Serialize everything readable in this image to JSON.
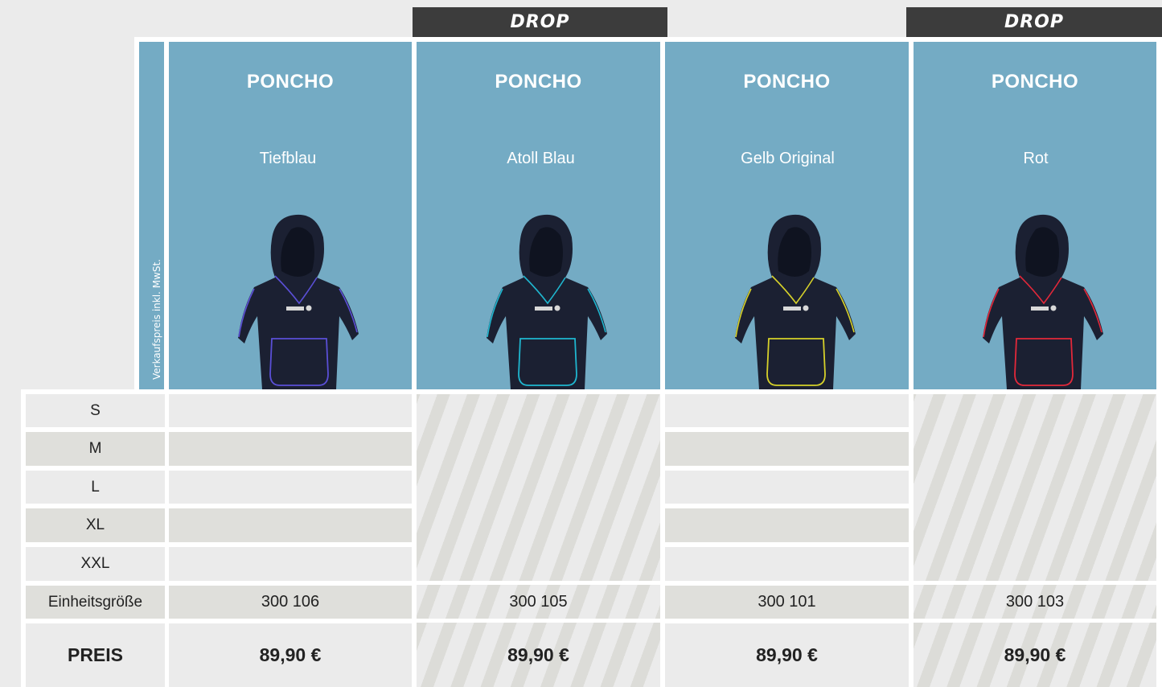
{
  "drop_banners": [
    "DROP",
    "DROP"
  ],
  "side_label": "Verkaufspreis inkl. MwSt.",
  "products": [
    {
      "name": "PONCHO",
      "color": "Tiefblau",
      "trim": "#5a4fd6",
      "article": "300 106",
      "price": "89,90 €",
      "drop": false
    },
    {
      "name": "PONCHO",
      "color": "Atoll Blau",
      "trim": "#1fb6cf",
      "article": "300 105",
      "price": "89,90 €",
      "drop": true
    },
    {
      "name": "PONCHO",
      "color": "Gelb Original",
      "trim": "#d6d12a",
      "article": "300 101",
      "price": "89,90 €",
      "drop": false
    },
    {
      "name": "PONCHO",
      "color": "Rot",
      "trim": "#e3283a",
      "article": "300 103",
      "price": "89,90 €",
      "drop": true
    }
  ],
  "rows": {
    "sizes": [
      "S",
      "M",
      "L",
      "XL",
      "XXL"
    ],
    "unit_size": "Einheitsgröße",
    "price": "PREIS"
  },
  "colors": {
    "panel_blue": "#74abc4",
    "banner": "#3c3c3c",
    "poncho_body": "#1b2032"
  }
}
